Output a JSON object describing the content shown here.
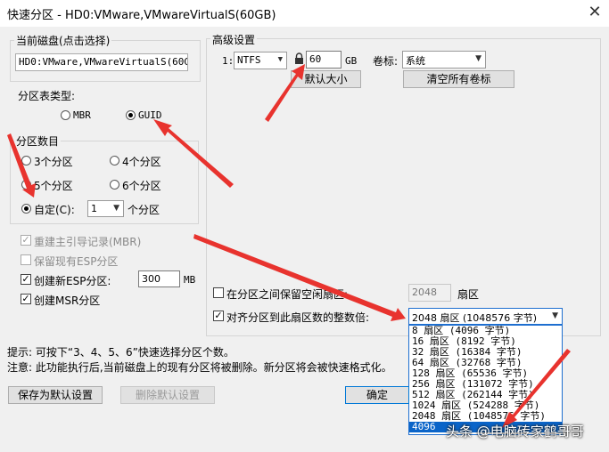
{
  "window": {
    "title": "快速分区 - HD0:VMware,VMwareVirtualS(60GB)",
    "close_icon": "close-icon"
  },
  "current_disk": {
    "legend": "当前磁盘(点击选择)",
    "value": "HD0:VMware,VMwareVirtualS(60GB)"
  },
  "partition_table": {
    "label": "分区表类型:",
    "options": [
      "MBR",
      "GUID"
    ],
    "selected": "GUID"
  },
  "partition_count": {
    "legend": "分区数目",
    "options": [
      "3个分区",
      "4个分区",
      "5个分区",
      "6个分区"
    ],
    "custom_label": "自定(C):",
    "custom_value": "1",
    "custom_suffix": "个分区",
    "selected": "自定(C):"
  },
  "options": {
    "rebuild_mbr": "重建主引导记录(MBR)",
    "keep_esp": "保留现有ESP分区",
    "create_esp": "创建新ESP分区:",
    "esp_size": "300",
    "esp_unit": "MB",
    "create_msr": "创建MSR分区"
  },
  "advanced": {
    "legend": "高级设置",
    "row_index": "1:",
    "fs": "NTFS",
    "size": "60",
    "size_unit": "GB",
    "volume_label_text": "卷标:",
    "volume_label_value": "系统",
    "default_size_button": "默认大小",
    "clear_labels_button": "清空所有卷标",
    "reserve_label": "在分区之间保留空闲扇区:",
    "reserve_value": "2048",
    "reserve_unit": "扇区",
    "align_label": "对齐分区到此扇区数的整数倍:",
    "align_value": "2048 扇区 (1048576 字节)"
  },
  "align_dropdown": {
    "items": [
      "8 扇区 (4096 字节)",
      "16 扇区 (8192 字节)",
      "32 扇区 (16384 字节)",
      "64 扇区 (32768 字节)",
      "128 扇区 (65536 字节)",
      "256 扇区 (131072 字节)",
      "512 扇区 (262144 字节)",
      "1024 扇区 (524288 字节)",
      "2048 扇区 (1048576 字节)",
      "4096"
    ],
    "selected_index": 9
  },
  "hints": {
    "tip": "提示: 可按下“3、4、5、6”快速选择分区个数。",
    "note": "注意: 此功能执行后,当前磁盘上的现有分区将被删除。新分区将会被快速格式化。"
  },
  "buttons": {
    "save_default": "保存为默认设置",
    "delete_default": "删除默认设置",
    "ok": "确定"
  },
  "watermark": "头条 @电脑砖家鹤哥哥",
  "colors": {
    "arrow": "#e8332e",
    "accent": "#0a64c8"
  }
}
